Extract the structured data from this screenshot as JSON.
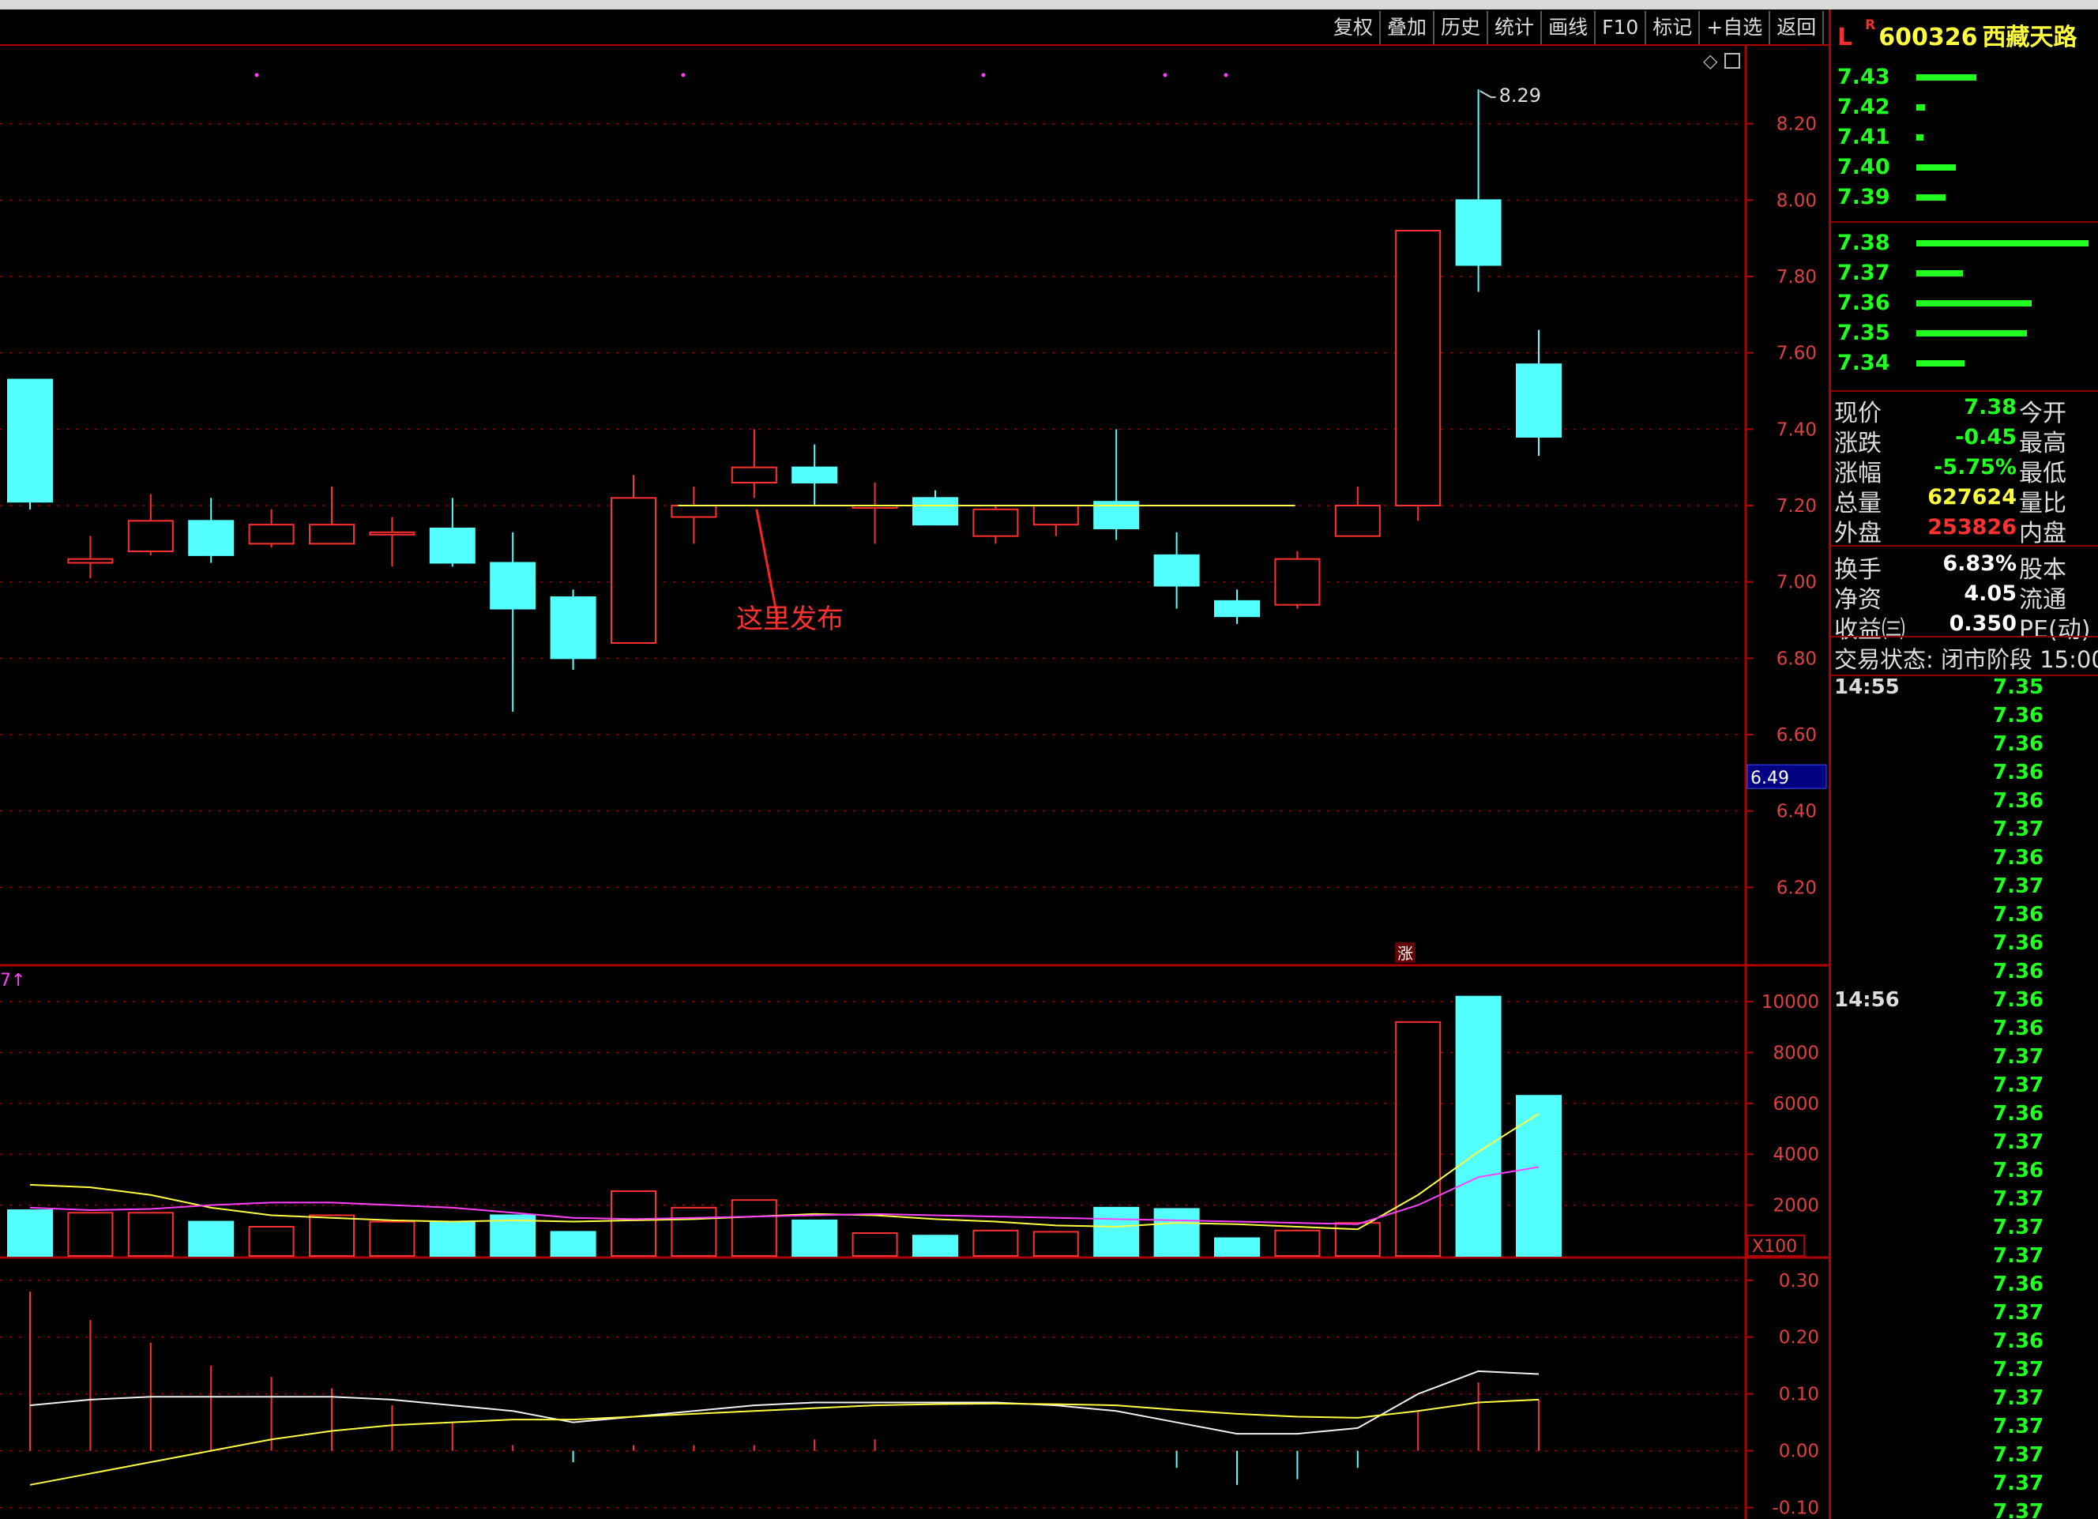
{
  "toolbar": [
    "复权",
    "叠加",
    "历史",
    "统计",
    "画线",
    "F10",
    "标记",
    "+自选",
    "返回"
  ],
  "stock": {
    "flag_l": "L",
    "flag_r": "R",
    "code": "600326",
    "name": "西藏天路"
  },
  "orderbook": {
    "asks": [
      {
        "price": "7.43",
        "vol": 0.35
      },
      {
        "price": "7.42",
        "vol": 0.05
      },
      {
        "price": "7.41",
        "vol": 0.04
      },
      {
        "price": "7.40",
        "vol": 0.23
      },
      {
        "price": "7.39",
        "vol": 0.17
      }
    ],
    "bids": [
      {
        "price": "7.38",
        "vol": 1.0
      },
      {
        "price": "7.37",
        "vol": 0.27
      },
      {
        "price": "7.36",
        "vol": 0.67
      },
      {
        "price": "7.35",
        "vol": 0.64
      },
      {
        "price": "7.34",
        "vol": 0.28
      }
    ]
  },
  "quote": [
    {
      "label": "现价",
      "value": "7.38",
      "right": "今开",
      "color": "#20ff20"
    },
    {
      "label": "涨跌",
      "value": "-0.45",
      "right": "最高",
      "color": "#20ff20"
    },
    {
      "label": "涨幅",
      "value": "-5.75%",
      "right": "最低",
      "color": "#20ff20"
    },
    {
      "label": "总量",
      "value": "627624",
      "right": "量比",
      "color": "#ffff40"
    },
    {
      "label": "外盘",
      "value": "253826",
      "right": "内盘",
      "color": "#ff3030"
    },
    {
      "label": "换手",
      "value": "6.83%",
      "right": "股本",
      "color": "#ffffff"
    },
    {
      "label": "净资",
      "value": "4.05",
      "right": "流通",
      "color": "#ffffff"
    },
    {
      "label": "收益㈢",
      "value": "0.350",
      "right": "PE(动)",
      "color": "#ffffff"
    }
  ],
  "trade_status": "交易状态: 闭市阶段 15:00",
  "ticks": [
    {
      "time": "14:55",
      "price": "7.35"
    },
    {
      "time": "",
      "price": "7.36"
    },
    {
      "time": "",
      "price": "7.36"
    },
    {
      "time": "",
      "price": "7.36"
    },
    {
      "time": "",
      "price": "7.36"
    },
    {
      "time": "",
      "price": "7.37"
    },
    {
      "time": "",
      "price": "7.36"
    },
    {
      "time": "",
      "price": "7.37"
    },
    {
      "time": "",
      "price": "7.36"
    },
    {
      "time": "",
      "price": "7.36"
    },
    {
      "time": "",
      "price": "7.36"
    },
    {
      "time": "14:56",
      "price": "7.36"
    },
    {
      "time": "",
      "price": "7.36"
    },
    {
      "time": "",
      "price": "7.37"
    },
    {
      "time": "",
      "price": "7.37"
    },
    {
      "time": "",
      "price": "7.36"
    },
    {
      "time": "",
      "price": "7.37"
    },
    {
      "time": "",
      "price": "7.36"
    },
    {
      "time": "",
      "price": "7.37"
    },
    {
      "time": "",
      "price": "7.37"
    },
    {
      "time": "",
      "price": "7.37"
    },
    {
      "time": "",
      "price": "7.36"
    },
    {
      "time": "",
      "price": "7.37"
    },
    {
      "time": "",
      "price": "7.36"
    },
    {
      "time": "",
      "price": "7.37"
    },
    {
      "time": "",
      "price": "7.37"
    },
    {
      "time": "",
      "price": "7.37"
    },
    {
      "time": "",
      "price": "7.37"
    },
    {
      "time": "",
      "price": "7.37"
    },
    {
      "time": "",
      "price": "7.37"
    }
  ],
  "chart_data": {
    "type": "candlestick",
    "price_axis": {
      "ticks": [
        "8.20",
        "8.00",
        "7.80",
        "7.60",
        "7.40",
        "7.20",
        "7.00",
        "6.80",
        "6.60",
        "6.40",
        "6.20"
      ],
      "ylim": [
        6.0,
        8.4
      ]
    },
    "cursor_price": "6.49",
    "max_label": "8.29",
    "annotation": "这里发布",
    "limit_marker": "涨",
    "volume_indicator_label": "7↑",
    "volume_axis": {
      "ticks": [
        "10000",
        "8000",
        "6000",
        "4000",
        "2000"
      ],
      "unit": "X100",
      "ylim": [
        0,
        10500
      ]
    },
    "macd_axis": {
      "ticks": [
        "0.30",
        "0.20",
        "0.10",
        "0.00",
        "-0.10"
      ],
      "ylim": [
        -0.12,
        0.34
      ]
    },
    "candles": [
      {
        "o": 7.53,
        "c": 7.21,
        "h": 7.53,
        "l": 7.19,
        "vol": 1800
      },
      {
        "o": 7.05,
        "c": 7.06,
        "h": 7.12,
        "l": 7.01,
        "vol": 1700
      },
      {
        "o": 7.08,
        "c": 7.16,
        "h": 7.23,
        "l": 7.07,
        "vol": 1700
      },
      {
        "o": 7.16,
        "c": 7.07,
        "h": 7.22,
        "l": 7.05,
        "vol": 1350
      },
      {
        "o": 7.1,
        "c": 7.15,
        "h": 7.19,
        "l": 7.09,
        "vol": 1150
      },
      {
        "o": 7.1,
        "c": 7.15,
        "h": 7.25,
        "l": 7.1,
        "vol": 1600
      },
      {
        "o": 7.13,
        "c": 7.13,
        "h": 7.17,
        "l": 7.04,
        "vol": 1350
      },
      {
        "o": 7.14,
        "c": 7.05,
        "h": 7.22,
        "l": 7.04,
        "vol": 1350
      },
      {
        "o": 7.05,
        "c": 6.93,
        "h": 7.13,
        "l": 6.66,
        "vol": 1600
      },
      {
        "o": 6.96,
        "c": 6.8,
        "h": 6.98,
        "l": 6.77,
        "vol": 950
      },
      {
        "o": 6.84,
        "c": 7.22,
        "h": 7.28,
        "l": 6.84,
        "vol": 2550
      },
      {
        "o": 7.17,
        "c": 7.2,
        "h": 7.25,
        "l": 7.1,
        "vol": 1900
      },
      {
        "o": 7.26,
        "c": 7.3,
        "h": 7.4,
        "l": 7.22,
        "vol": 2200
      },
      {
        "o": 7.3,
        "c": 7.26,
        "h": 7.36,
        "l": 7.2,
        "vol": 1400
      },
      {
        "o": 7.2,
        "c": 7.2,
        "h": 7.26,
        "l": 7.1,
        "vol": 900
      },
      {
        "o": 7.22,
        "c": 7.15,
        "h": 7.24,
        "l": 7.15,
        "vol": 800
      },
      {
        "o": 7.12,
        "c": 7.19,
        "h": 7.2,
        "l": 7.1,
        "vol": 1000
      },
      {
        "o": 7.15,
        "c": 7.2,
        "h": 7.2,
        "l": 7.12,
        "vol": 950
      },
      {
        "o": 7.21,
        "c": 7.14,
        "h": 7.4,
        "l": 7.11,
        "vol": 1900
      },
      {
        "o": 7.07,
        "c": 6.99,
        "h": 7.13,
        "l": 6.93,
        "vol": 1850
      },
      {
        "o": 6.95,
        "c": 6.91,
        "h": 6.98,
        "l": 6.89,
        "vol": 700
      },
      {
        "o": 6.94,
        "c": 7.06,
        "h": 7.08,
        "l": 6.93,
        "vol": 1000
      },
      {
        "o": 7.12,
        "c": 7.2,
        "h": 7.25,
        "l": 7.12,
        "vol": 1300
      },
      {
        "o": 7.2,
        "c": 7.92,
        "h": 7.92,
        "l": 7.16,
        "vol": 9200
      },
      {
        "o": 8.0,
        "c": 7.83,
        "h": 8.29,
        "l": 7.76,
        "vol": 10200
      },
      {
        "o": 7.57,
        "c": 7.38,
        "h": 7.66,
        "l": 7.33,
        "vol": 6300
      }
    ],
    "vol_ma_yellow": [
      2800,
      2700,
      2400,
      1900,
      1600,
      1500,
      1400,
      1350,
      1400,
      1350,
      1400,
      1450,
      1550,
      1650,
      1600,
      1450,
      1350,
      1200,
      1150,
      1300,
      1250,
      1150,
      1050,
      2400,
      4100,
      5600
    ],
    "vol_ma_magenta": [
      1900,
      1800,
      1850,
      2000,
      2100,
      2100,
      2000,
      1900,
      1700,
      1500,
      1450,
      1500,
      1550,
      1600,
      1650,
      1600,
      1550,
      1500,
      1450,
      1400,
      1350,
      1300,
      1250,
      2000,
      3100,
      3500
    ],
    "macd_hist": [
      0.28,
      0.23,
      0.19,
      0.15,
      0.13,
      0.11,
      0.08,
      0.05,
      0.01,
      -0.02,
      0.01,
      0.01,
      0.01,
      0.02,
      0.02,
      0.0,
      0.0,
      0.0,
      0.0,
      -0.03,
      -0.06,
      -0.05,
      -0.03,
      0.07,
      0.12,
      0.09
    ],
    "macd_dif": [
      0.08,
      0.09,
      0.095,
      0.095,
      0.095,
      0.095,
      0.09,
      0.08,
      0.07,
      0.05,
      0.06,
      0.07,
      0.08,
      0.085,
      0.085,
      0.085,
      0.085,
      0.08,
      0.07,
      0.05,
      0.03,
      0.03,
      0.04,
      0.1,
      0.14,
      0.135
    ],
    "macd_dea": [
      -0.06,
      -0.04,
      -0.02,
      0.0,
      0.02,
      0.035,
      0.045,
      0.05,
      0.055,
      0.055,
      0.06,
      0.065,
      0.07,
      0.075,
      0.08,
      0.082,
      0.083,
      0.082,
      0.08,
      0.072,
      0.065,
      0.06,
      0.058,
      0.07,
      0.085,
      0.09
    ],
    "ma_yellow_segment": {
      "from_index": 11,
      "to_index": 19,
      "value": 7.2
    }
  }
}
